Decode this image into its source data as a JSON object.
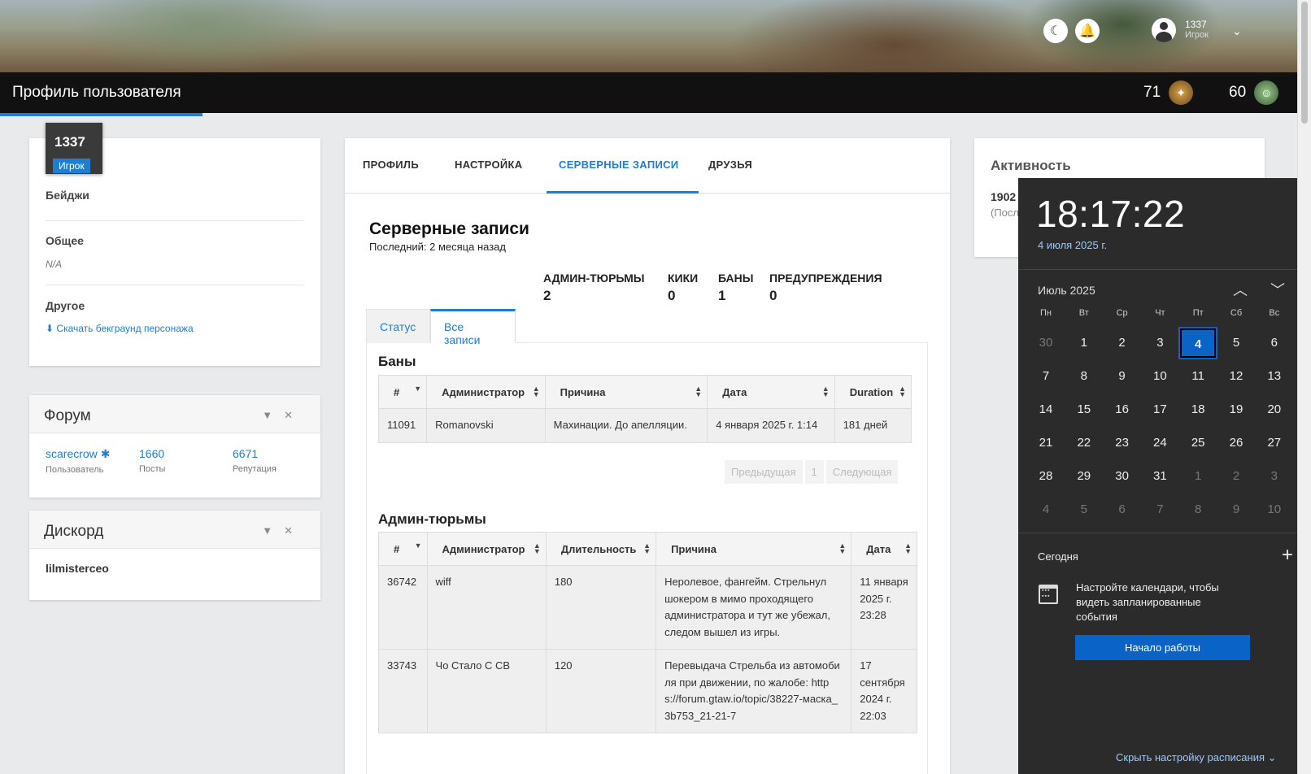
{
  "header": {
    "user_name": "1337",
    "user_role": "Игрок",
    "page_title": "Профиль пользователя",
    "stat1": "71",
    "stat2": "60"
  },
  "profile": {
    "id": "1337",
    "role_tag": "Игрок",
    "badges_title": "Бейджи",
    "general_title": "Общее",
    "general_value": "N/A",
    "other_title": "Другое",
    "download_link": "Скачать бекграунд персонажа"
  },
  "forum": {
    "title": "Форум",
    "user": "scarecrow",
    "user_label": "Пользователь",
    "posts": "1660",
    "posts_label": "Посты",
    "rep": "6671",
    "rep_label": "Репутация"
  },
  "discord": {
    "title": "Дискорд",
    "value": "lilmisterceo"
  },
  "tabs": [
    "ПРОФИЛЬ",
    "НАСТРОЙКА",
    "СЕРВЕРНЫЕ ЗАПИСИ",
    "ДРУЗЬЯ"
  ],
  "records": {
    "title": "Серверные записи",
    "last": "Последний: 2 месяца назад",
    "counters": [
      {
        "label": "АДМИН-ТЮРЬМЫ",
        "value": "2"
      },
      {
        "label": "КИКИ",
        "value": "0"
      },
      {
        "label": "БАНЫ",
        "value": "1"
      },
      {
        "label": "ПРЕДУПРЕЖДЕНИЯ",
        "value": "0"
      }
    ],
    "subtabs": [
      "Статус",
      "Все записи"
    ],
    "bans_title": "Баны",
    "bans_headers": [
      "#",
      "Администратор",
      "Причина",
      "Дата",
      "Duration"
    ],
    "bans_rows": [
      [
        "11091",
        "Romanovski",
        "Махинации. До апелляции.",
        "4 января 2025 г. 1:14",
        "181 дней"
      ]
    ],
    "pager": [
      "Предыдущая",
      "1",
      "Следующая"
    ],
    "jails_title": "Админ-тюрьмы",
    "jails_headers": [
      "#",
      "Администратор",
      "Длительность",
      "Причина",
      "Дата"
    ],
    "jails_rows": [
      [
        "36742",
        "wiff",
        "180",
        "Неролевое, фангейм. Стрельнул шокером в мимо проходящего администратора и тут же убежал, следом вышел из игры.",
        "11 января 2025 г. 23:28"
      ],
      [
        "33743",
        "Чо Стало С СВ",
        "120",
        "Перевыдача Стрельба из автомобиля при движении, по жалобе: https://forum.gtaw.io/topic/38227-маска_3b753_21-21-7",
        "17 сентября 2024 г. 22:03"
      ]
    ]
  },
  "activity": {
    "title": "Активность",
    "value": "1902",
    "label": "(Посл"
  },
  "flyout": {
    "time": "18:17:22",
    "date": "4 июля 2025 г.",
    "month": "Июль 2025",
    "weekdays": [
      "Пн",
      "Вт",
      "Ср",
      "Чт",
      "Пт",
      "Сб",
      "Вс"
    ],
    "days": [
      [
        "30",
        "1",
        "2",
        "3",
        "4",
        "5",
        "6"
      ],
      [
        "7",
        "8",
        "9",
        "10",
        "11",
        "12",
        "13"
      ],
      [
        "14",
        "15",
        "16",
        "17",
        "18",
        "19",
        "20"
      ],
      [
        "21",
        "22",
        "23",
        "24",
        "25",
        "26",
        "27"
      ],
      [
        "28",
        "29",
        "30",
        "31",
        "1",
        "2",
        "3"
      ],
      [
        "4",
        "5",
        "6",
        "7",
        "8",
        "9",
        "10"
      ]
    ],
    "today_label": "Сегодня",
    "message": "Настройте календари, чтобы видеть запланированные события",
    "start_button": "Начало работы",
    "hide_link": "Скрыть настройку расписания"
  }
}
